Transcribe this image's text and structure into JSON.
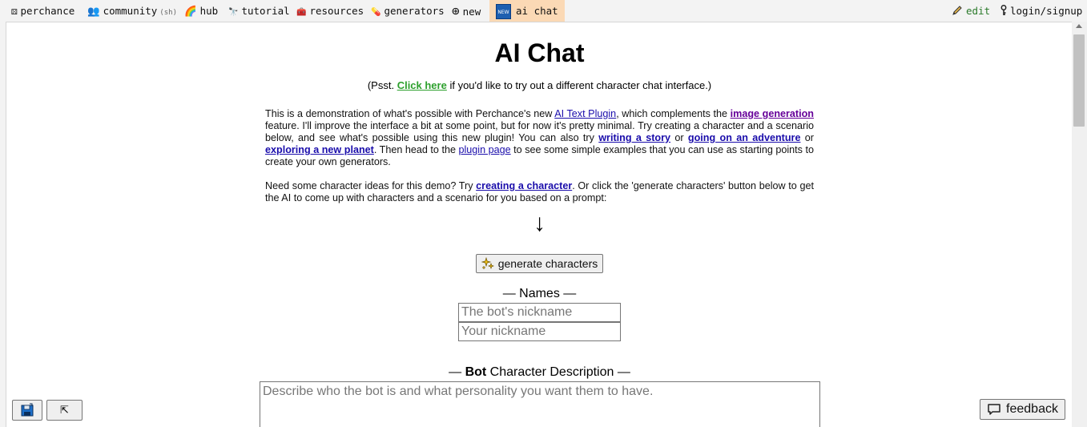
{
  "nav": {
    "items": [
      {
        "label": "perchance",
        "icon": "dice-icon",
        "glyph": "⚄"
      },
      {
        "label": "community",
        "icon": "people-icon",
        "glyph": "👥",
        "suffix": "(sh)"
      },
      {
        "label": "hub",
        "icon": "rainbow-icon",
        "glyph": "🌈"
      },
      {
        "label": "tutorial",
        "icon": "binoculars-icon",
        "glyph": "🔭"
      },
      {
        "label": "resources",
        "icon": "toolbox-icon",
        "glyph": "🧰"
      },
      {
        "label": "generators",
        "icon": "pill-icon",
        "glyph": "💊"
      },
      {
        "label": "new",
        "icon": "plus-circle-icon",
        "glyph": "⊕"
      },
      {
        "label": "ai chat",
        "icon": "new-badge-icon",
        "badge": "NEW"
      }
    ],
    "edit": "edit",
    "login": "login/signup"
  },
  "page": {
    "title": "AI Chat",
    "psst_prefix": "(Psst. ",
    "psst_link": "Click here",
    "psst_suffix": " if you'd like to try out a different character chat interface.)",
    "intro": [
      "This is a demonstration of what's possible with Perchance's new ",
      "AI Text Plugin",
      ", which complements the ",
      "image generation",
      " feature. I'll improve the interface a bit at some point, but for now it's pretty minimal. Try creating a character and a scenario below, and see what's possible using this new plugin! You can also try ",
      "writing a story",
      " or ",
      "going on an adventure",
      " or ",
      "exploring a new planet",
      ". Then head to the ",
      "plugin page",
      " to see some simple examples that you can use as starting points to create your own generators."
    ],
    "ideas": [
      "Need some character ideas for this demo? Try ",
      "creating a character",
      ". Or click the 'generate characters' button below to get the AI to come up with characters and a scenario for you based on a prompt:"
    ],
    "arrow": "↓",
    "generate_button": "generate characters",
    "names_label": "— Names —",
    "bot_nickname_placeholder": "The bot's nickname",
    "your_nickname_placeholder": "Your nickname",
    "desc_label_prefix": "— ",
    "desc_label_bold": "Bot",
    "desc_label_suffix": " Character Description —",
    "desc_placeholder": "Describe who the bot is and what personality you want them to have."
  },
  "floating": {
    "btn2_glyph": "⇱",
    "feedback": "feedback"
  }
}
